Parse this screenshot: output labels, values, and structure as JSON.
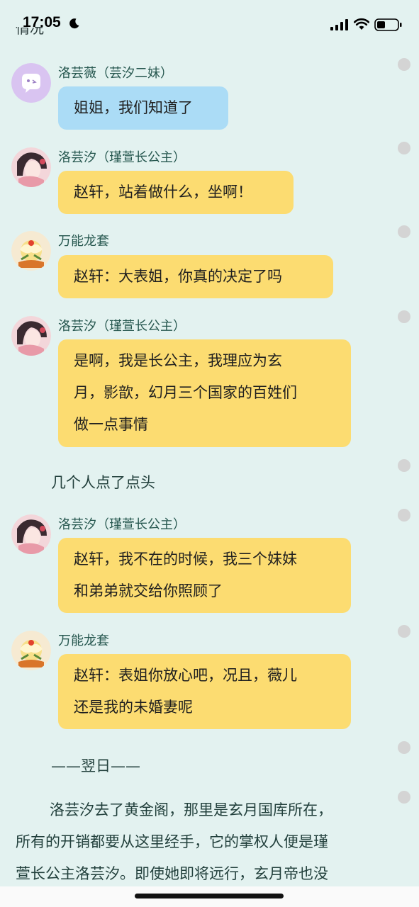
{
  "status_bar": {
    "time": "17:05"
  },
  "top_cut_text": "情况",
  "messages": [
    {
      "sender": "洛芸薇（芸汐二妹）",
      "lines": [
        "姐姐，我们知道了"
      ],
      "color": "blue",
      "avatar": "lavender-cat-avatar"
    },
    {
      "sender": "洛芸汐（瑾萱长公主）",
      "lines": [
        "赵轩，站着做什么，坐啊！"
      ],
      "color": "yellow",
      "avatar": "princess-avatar"
    },
    {
      "sender": "万能龙套",
      "lines": [
        "赵轩：大表姐，你真的决定了吗"
      ],
      "color": "yellow",
      "avatar": "flower-avatar"
    },
    {
      "sender": "洛芸汐（瑾萱长公主）",
      "lines": [
        "是啊，我是长公主，我理应为玄",
        "月，影歆，幻月三个国家的百姓们",
        "做一点事情"
      ],
      "color": "yellow",
      "avatar": "princess-avatar"
    },
    {
      "sender": "洛芸汐（瑾萱长公主）",
      "lines": [
        "赵轩，我不在的时候，我三个妹妹",
        "和弟弟就交给你照顾了"
      ],
      "color": "yellow",
      "avatar": "princess-avatar"
    },
    {
      "sender": "万能龙套",
      "lines": [
        "赵轩：表姐你放心吧，况且，薇儿",
        "还是我的未婚妻呢"
      ],
      "color": "yellow",
      "avatar": "flower-avatar"
    }
  ],
  "narration_nod": "几个人点了点头",
  "narration_next_day": "——翌日——",
  "paragraph_lines": [
    "洛芸汐去了黄金阁，那里是玄月国库所在，",
    "所有的开销都要从这里经手，它的掌权人便是瑾",
    "萱长公主洛芸汐。即使她即将远行，玄月帝也没"
  ],
  "colors": {
    "background": "#e3f2f0",
    "bubble_yellow": "#fcdc71",
    "bubble_blue": "#abdcf6",
    "name_text": "#26574f"
  }
}
